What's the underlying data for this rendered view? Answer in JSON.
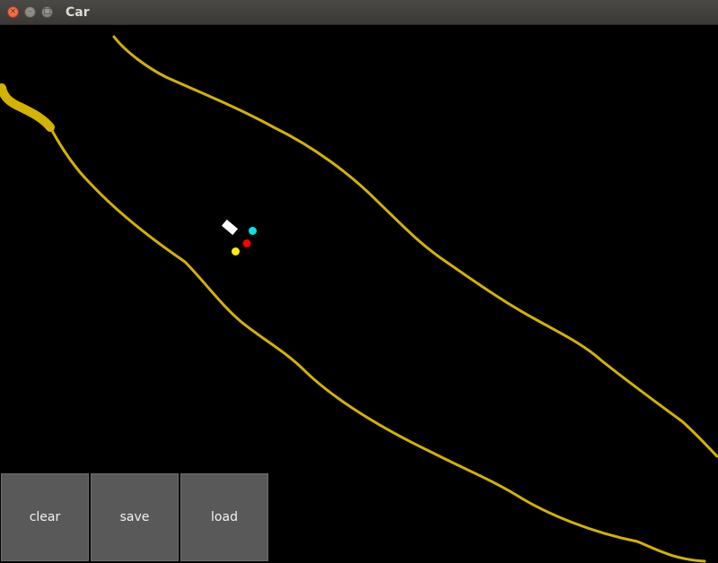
{
  "window": {
    "title": "Car",
    "close_glyph": "×",
    "minimize_glyph": "–",
    "maximize_glyph": "□"
  },
  "canvas": {
    "background": "#000000",
    "sand_color": "#d4b300",
    "car_color": "#ffffff",
    "sensors": [
      {
        "name": "sensor-cyan",
        "color": "#00e5e5"
      },
      {
        "name": "sensor-red",
        "color": "#ff0000"
      },
      {
        "name": "sensor-yellow",
        "color": "#ffee00"
      }
    ]
  },
  "buttons": {
    "clear": "clear",
    "save": "save",
    "load": "load"
  }
}
